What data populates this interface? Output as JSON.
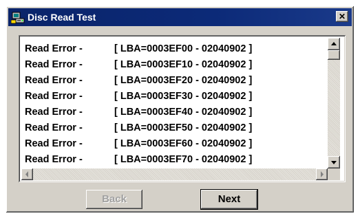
{
  "window": {
    "title": "Disc Read Test",
    "icon": "disc-drive-icon",
    "close_label": "✕"
  },
  "log": {
    "lines": [
      {
        "label": "Read Error -",
        "detail": "[ LBA=0003EF00 - 02040902 ]"
      },
      {
        "label": "Read Error -",
        "detail": "[ LBA=0003EF10 - 02040902 ]"
      },
      {
        "label": "Read Error -",
        "detail": "[ LBA=0003EF20 - 02040902 ]"
      },
      {
        "label": "Read Error -",
        "detail": "[ LBA=0003EF30 - 02040902 ]"
      },
      {
        "label": "Read Error -",
        "detail": "[ LBA=0003EF40 - 02040902 ]"
      },
      {
        "label": "Read Error -",
        "detail": "[ LBA=0003EF50 - 02040902 ]"
      },
      {
        "label": "Read Error -",
        "detail": "[ LBA=0003EF60 - 02040902 ]"
      },
      {
        "label": "Read Error -",
        "detail": "[ LBA=0003EF70 - 02040902 ]"
      }
    ]
  },
  "buttons": {
    "back_label": "Back",
    "next_label": "Next"
  },
  "colors": {
    "titlebar": "#0a246a",
    "face": "#d4d0c8",
    "disabled_text": "#a0a0a0"
  }
}
